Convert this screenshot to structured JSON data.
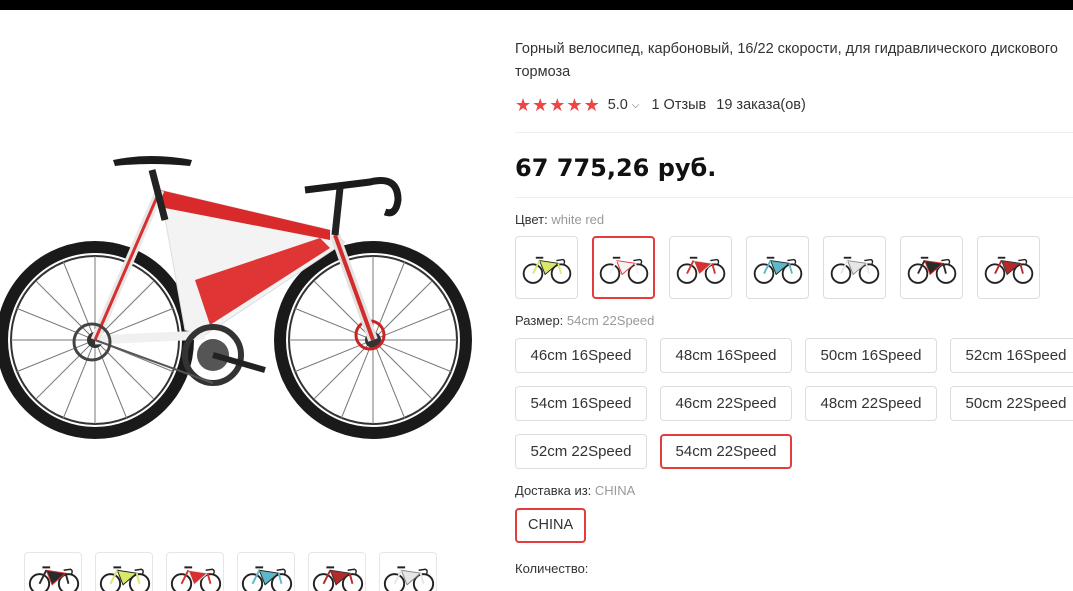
{
  "product": {
    "title": "Горный велосипед, карбоновый, 16/22 скорости, для гидравлического дискового тормоза",
    "rating": "5.0",
    "reviews": "1 Отзыв",
    "orders": "19 заказа(ов)",
    "price": "67 775,26 руб."
  },
  "color": {
    "label": "Цвет: ",
    "selected": "white red",
    "options": [
      {
        "name": "yellow black",
        "frame": "#d9e86a",
        "accent": "#222"
      },
      {
        "name": "white red",
        "frame": "#f2f2f2",
        "accent": "#e23030"
      },
      {
        "name": "red white",
        "frame": "#d63030",
        "accent": "#eee"
      },
      {
        "name": "blue black",
        "frame": "#5fb8c8",
        "accent": "#222"
      },
      {
        "name": "white grey",
        "frame": "#e6e6e6",
        "accent": "#888"
      },
      {
        "name": "black",
        "frame": "#2a2a2a",
        "accent": "#d33"
      },
      {
        "name": "red black",
        "frame": "#b42a2a",
        "accent": "#333"
      }
    ]
  },
  "size": {
    "label": "Размер: ",
    "selected": "54cm 22Speed",
    "options": [
      "46cm 16Speed",
      "48cm 16Speed",
      "50cm 16Speed",
      "52cm 16Speed",
      "54cm 16Speed",
      "46cm 22Speed",
      "48cm 22Speed",
      "50cm 22Speed",
      "52cm 22Speed",
      "54cm 22Speed"
    ]
  },
  "shipping": {
    "label": "Доставка из: ",
    "selected": "CHINA",
    "options": [
      "CHINA"
    ]
  },
  "quantity": {
    "label": "Количество:"
  },
  "thumbnails": [
    {
      "frame": "#2a2a2a",
      "accent": "#d33"
    },
    {
      "frame": "#d9e86a",
      "accent": "#222"
    },
    {
      "frame": "#d63030",
      "accent": "#eee"
    },
    {
      "frame": "#5fb8c8",
      "accent": "#222"
    },
    {
      "frame": "#b42a2a",
      "accent": "#333"
    },
    {
      "frame": "#e6e6e6",
      "accent": "#888"
    }
  ],
  "colors": {
    "accent": "#e43b3b",
    "star": "#ee4545"
  }
}
